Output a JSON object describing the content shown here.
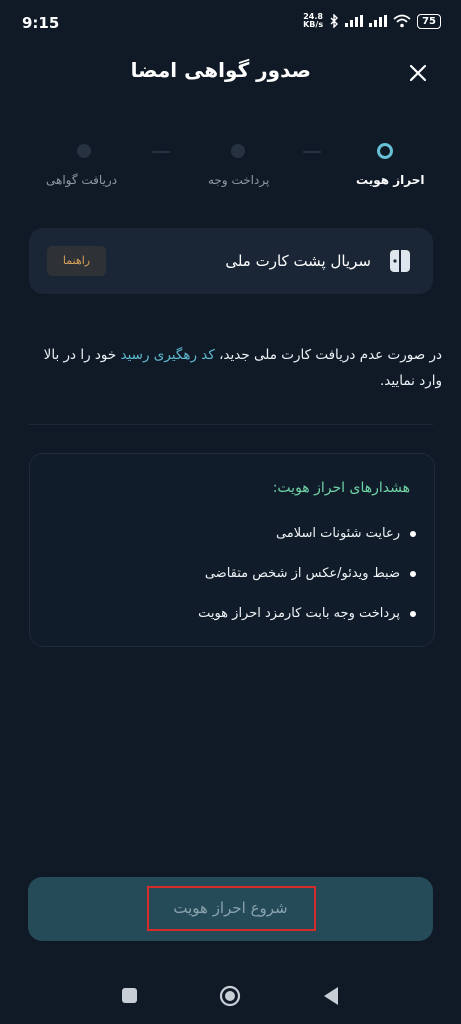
{
  "status_bar": {
    "time": "9:15",
    "net_speed_value": "24.8",
    "net_speed_unit": "KB/s",
    "battery": "75"
  },
  "header": {
    "title": "صدور گواهی امضا"
  },
  "stepper": {
    "steps": [
      {
        "label": "احراز هویت",
        "state": "active"
      },
      {
        "label": "پرداخت وجه",
        "state": "inactive"
      },
      {
        "label": "دریافت گواهی",
        "state": "inactive"
      }
    ]
  },
  "serial_card": {
    "label": "سریال پشت کارت ملی",
    "guide_button": "راهنما"
  },
  "info": {
    "before_link": "در صورت عدم دریافت کارت ملی جدید، ",
    "link": "کد رهگیری رسید",
    "after_link": " خود را در بالا وارد نمایید."
  },
  "warnings": {
    "title": "هشدارهای احراز هویت:",
    "items": [
      "رعایت شئونات اسلامی",
      "ضبط ویدئو/عکس از شخص متقاضی",
      "پرداخت وجه بابت کارمزد احراز هویت"
    ]
  },
  "start_button": {
    "label": "شروع احراز هویت"
  },
  "colors": {
    "background": "#0f1a26",
    "accent": "#67c0d6",
    "warning_title": "#6fd3a6",
    "highlight_box": "#d42b2b"
  }
}
